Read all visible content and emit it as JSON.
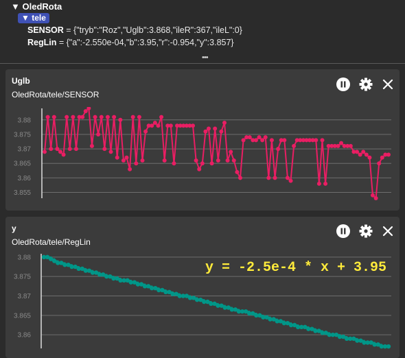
{
  "tree": {
    "root_label": "OledRota",
    "child_label": "tele",
    "rows": [
      {
        "key": "SENSOR",
        "value": "{\"tryb\":\"Roz\",\"Uglb\":3.868,\"ileR\":367,\"ileL\":0}"
      },
      {
        "key": "RegLin",
        "value": "{\"a\":-2.550e-04,\"b\":3.95,\"r\":-0.954,\"y\":3.857}"
      }
    ],
    "more_label": "•••"
  },
  "panels": [
    {
      "title": "Uglb",
      "topic": "OledRota/tele/SENSOR",
      "color": "#e91e63",
      "chart_data": {
        "type": "line",
        "yticks": [
          "3.88",
          "3.875",
          "3.87",
          "3.865",
          "3.86",
          "3.855"
        ],
        "ylim": [
          3.853,
          3.8835
        ],
        "grid": true,
        "series": [
          {
            "values": [
              3.869,
              3.881,
              3.87,
              3.881,
              3.87,
              3.869,
              3.868,
              3.881,
              3.87,
              3.881,
              3.87,
              3.881,
              3.881,
              3.883,
              3.884,
              3.871,
              3.881,
              3.875,
              3.881,
              3.87,
              3.881,
              3.869,
              3.881,
              3.867,
              3.88,
              3.866,
              3.867,
              3.863,
              3.881,
              3.865,
              3.881,
              3.866,
              3.876,
              3.878,
              3.878,
              3.879,
              3.878,
              3.881,
              3.866,
              3.878,
              3.878,
              3.865,
              3.878,
              3.878,
              3.878,
              3.878,
              3.878,
              3.878,
              3.866,
              3.863,
              3.865,
              3.876,
              3.877,
              3.865,
              3.877,
              3.866,
              3.876,
              3.879,
              3.866,
              3.869,
              3.866,
              3.862,
              3.86,
              3.873,
              3.874,
              3.874,
              3.873,
              3.873,
              3.874,
              3.873,
              3.874,
              3.86,
              3.873,
              3.86,
              3.87,
              3.873,
              3.873,
              3.86,
              3.859,
              3.871,
              3.873,
              3.873,
              3.873,
              3.873,
              3.873,
              3.873,
              3.873,
              3.858,
              3.873,
              3.858,
              3.871,
              3.871,
              3.871,
              3.871,
              3.872,
              3.871,
              3.871,
              3.871,
              3.869,
              3.869,
              3.868,
              3.869,
              3.868,
              3.867,
              3.854,
              3.853,
              3.865,
              3.867,
              3.868,
              3.868
            ]
          }
        ]
      }
    },
    {
      "title": "y",
      "topic": "OledRota/tele/RegLin",
      "color": "#009688",
      "formula": "y = -2.5e-4 * x + 3.95",
      "chart_data": {
        "type": "line",
        "yticks": [
          "3.88",
          "3.875",
          "3.87",
          "3.865",
          "3.86"
        ],
        "ylim": [
          3.8565,
          3.8805
        ],
        "grid": true,
        "series": [
          {
            "values": [
              3.88,
              3.88,
              3.8795,
              3.879,
              3.8785,
              3.8785,
              3.878,
              3.878,
              3.8775,
              3.8775,
              3.877,
              3.877,
              3.8765,
              3.8765,
              3.876,
              3.876,
              3.8755,
              3.8755,
              3.875,
              3.875,
              3.8745,
              3.8745,
              3.874,
              3.874,
              3.874,
              3.8735,
              3.8735,
              3.873,
              3.873,
              3.8725,
              3.8725,
              3.872,
              3.872,
              3.8715,
              3.8715,
              3.871,
              3.871,
              3.8705,
              3.8705,
              3.87,
              3.87,
              3.87,
              3.8695,
              3.8695,
              3.869,
              3.869,
              3.8685,
              3.8685,
              3.868,
              3.868,
              3.8675,
              3.8675,
              3.867,
              3.867,
              3.8665,
              3.8665,
              3.866,
              3.866,
              3.866,
              3.8655,
              3.8655,
              3.865,
              3.865,
              3.8645,
              3.8645,
              3.864,
              3.864,
              3.8635,
              3.8635,
              3.863,
              3.863,
              3.8625,
              3.8625,
              3.862,
              3.862,
              3.862,
              3.8615,
              3.8615,
              3.861,
              3.861,
              3.8605,
              3.8605,
              3.86,
              3.86,
              3.86,
              3.8595,
              3.8595,
              3.859,
              3.859,
              3.859,
              3.8585,
              3.8585,
              3.858,
              3.858,
              3.858,
              3.8575,
              3.8575,
              3.857,
              3.857,
              3.857
            ]
          }
        ]
      }
    }
  ]
}
